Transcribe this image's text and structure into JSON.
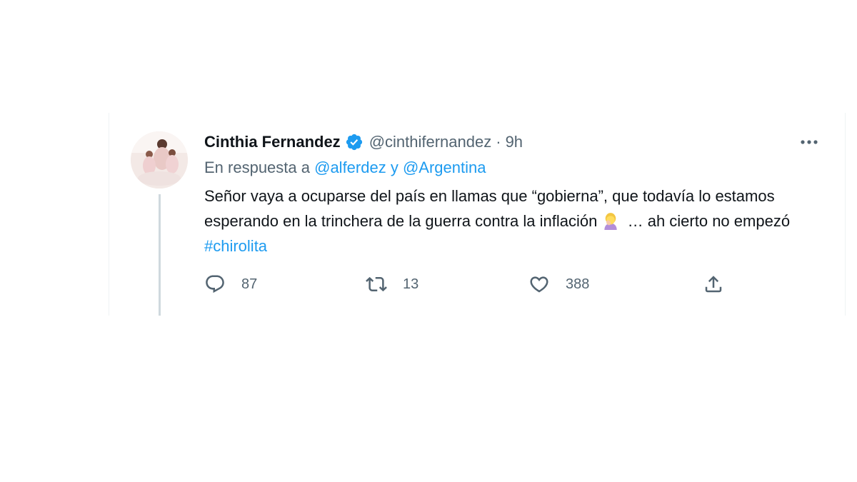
{
  "tweet": {
    "display_name": "Cinthia Fernandez",
    "verified": true,
    "handle": "@cinthifernandez",
    "separator": "·",
    "time": "9h",
    "reply_prefix": "En respuesta a",
    "reply_user_1": "@alferdez",
    "reply_conjunction": "y",
    "reply_user_2": "@Argentina",
    "text_part1": "Señor vaya a ocuparse del país en llamas que “gobierna”,  que todavía lo estamos esperando en la trinchera de la guerra contra la inflación",
    "emoji_name": "woman-facepalming-emoji",
    "text_part2": "… ah cierto no empezó",
    "hashtag": "#chirolita",
    "counts": {
      "replies": "87",
      "retweets": "13",
      "likes": "388"
    }
  },
  "icons": {
    "verified": "verified-badge-icon",
    "more": "more-options-icon",
    "reply": "reply-icon",
    "retweet": "retweet-icon",
    "like": "heart-icon",
    "share": "share-icon"
  },
  "colors": {
    "link": "#1d9bf0",
    "secondary_text": "#536471",
    "primary_text": "#0f1419",
    "verified": "#1d9bf0",
    "thread_line": "#cfd9de"
  }
}
